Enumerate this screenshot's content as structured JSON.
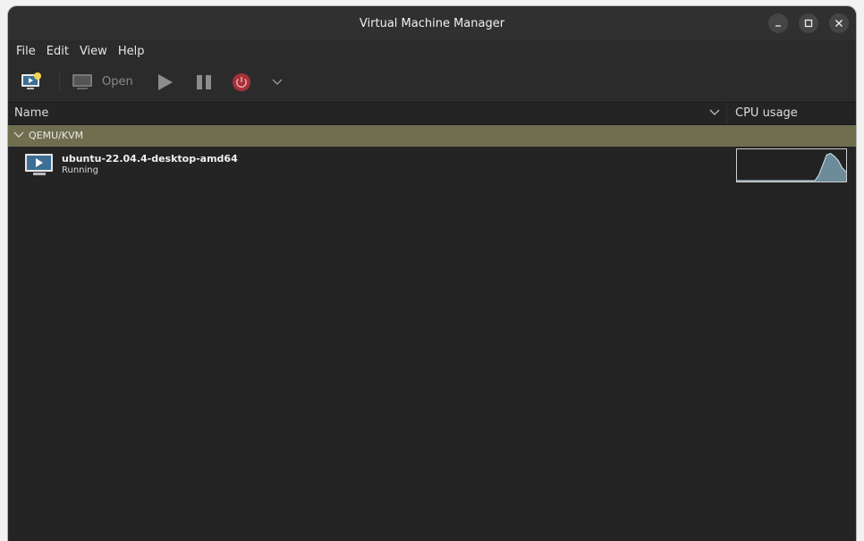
{
  "window": {
    "title": "Virtual Machine Manager"
  },
  "menu": [
    "File",
    "Edit",
    "View",
    "Help"
  ],
  "toolbar": {
    "open_label": "Open"
  },
  "columns": {
    "name": "Name",
    "cpu": "CPU usage"
  },
  "group": {
    "label": "QEMU/KVM"
  },
  "vms": [
    {
      "name": "ubuntu-22.04.4-desktop-amd64",
      "status": "Running",
      "cpu_history": [
        0,
        0,
        0,
        0,
        0,
        0,
        0,
        0,
        0,
        0,
        0,
        0,
        0,
        0,
        0,
        0,
        0,
        0,
        0,
        0,
        0,
        0.2,
        0.55,
        0.9,
        0.95,
        0.85,
        0.7,
        0.45,
        0.3
      ]
    }
  ],
  "colors": {
    "group_bg": "#6f6e4f",
    "power": "#a8303a",
    "graph": "#8fb8cc"
  }
}
